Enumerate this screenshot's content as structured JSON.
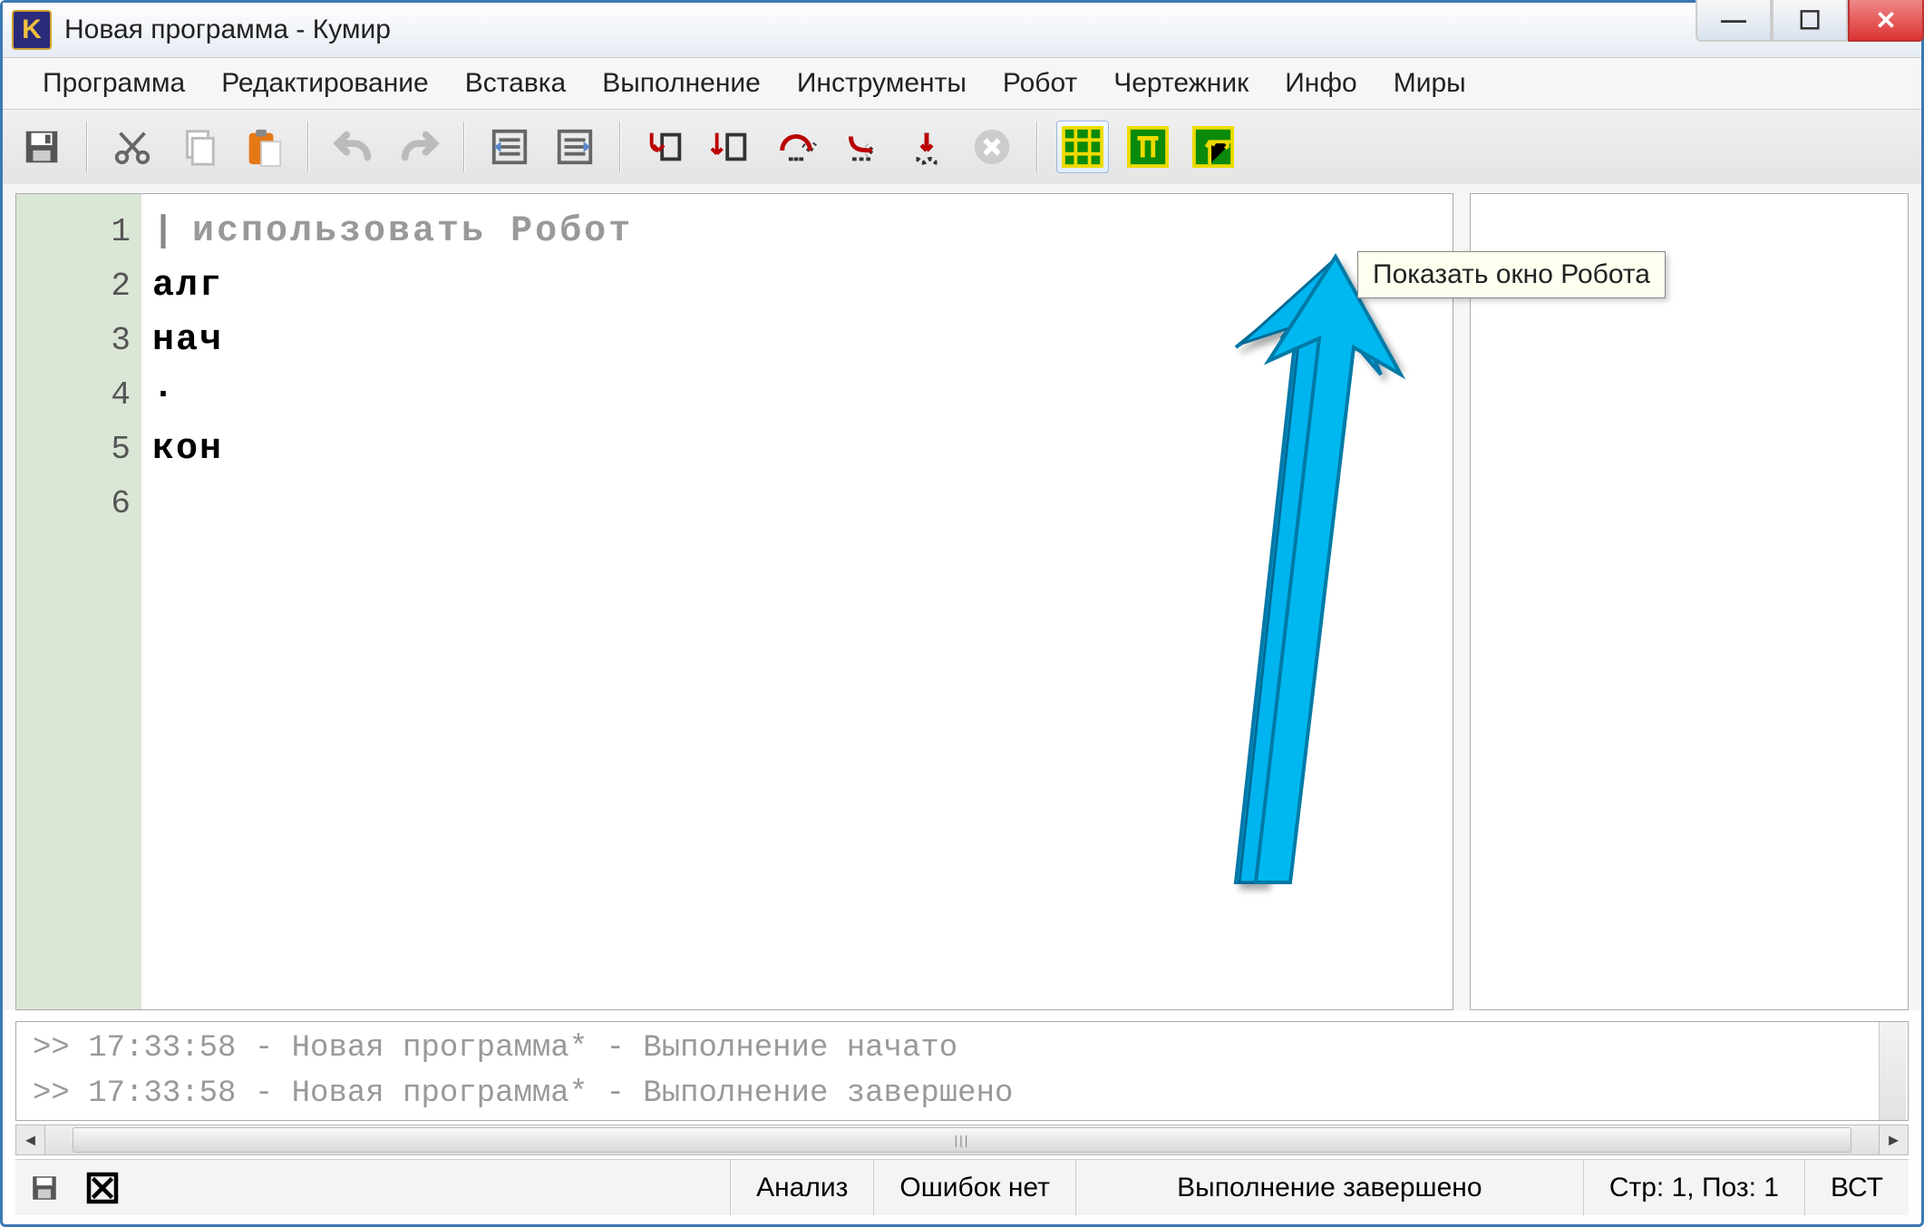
{
  "title": "Новая программа - Кумир",
  "app_icon_letter": "K",
  "window_controls": {
    "minimize": "—",
    "maximize": "☐",
    "close": "✕"
  },
  "menu": [
    "Программа",
    "Редактирование",
    "Вставка",
    "Выполнение",
    "Инструменты",
    "Робот",
    "Чертежник",
    "Инфо",
    "Миры"
  ],
  "tooltip": "Показать окно Робота",
  "editor": {
    "gutter": [
      "1",
      "2",
      "3",
      "4",
      "5",
      "6"
    ],
    "lines": [
      {
        "pipe": "|",
        "text": "использовать Робот",
        "style": "comm"
      },
      {
        "text": "алг",
        "style": "kw"
      },
      {
        "text": "нач",
        "style": "kw"
      },
      {
        "text": "·",
        "style": "kw"
      },
      {
        "text": "кон",
        "style": "kw"
      },
      {
        "text": "",
        "style": ""
      }
    ]
  },
  "console": [
    ">> 17:33:58 - Новая программа* - Выполнение начато",
    ">> 17:33:58 - Новая программа* - Выполнение завершено"
  ],
  "status": {
    "analysis": "Анализ",
    "errors": "Ошибок нет",
    "exec": "Выполнение завершено",
    "pos": "Стр: 1, Поз: 1",
    "mode": "ВСТ"
  },
  "icons": {
    "save": "save-icon",
    "cut": "cut-icon",
    "copy": "copy-icon",
    "paste": "paste-icon",
    "undo": "undo-icon",
    "redo": "redo-icon",
    "indent": "indent-icon",
    "outdent": "outdent-icon",
    "run": "run-icon",
    "step": "step-icon",
    "stepover": "stepover-icon",
    "stepout": "stepout-icon",
    "stepinto": "stepinto-icon",
    "stop": "stop-icon",
    "robot-grid": "robot-grid-icon",
    "robot-pi": "robot-pi-icon",
    "robot-axes": "robot-axes-icon",
    "st-save": "save-small-icon",
    "st-error": "error-x-icon"
  }
}
